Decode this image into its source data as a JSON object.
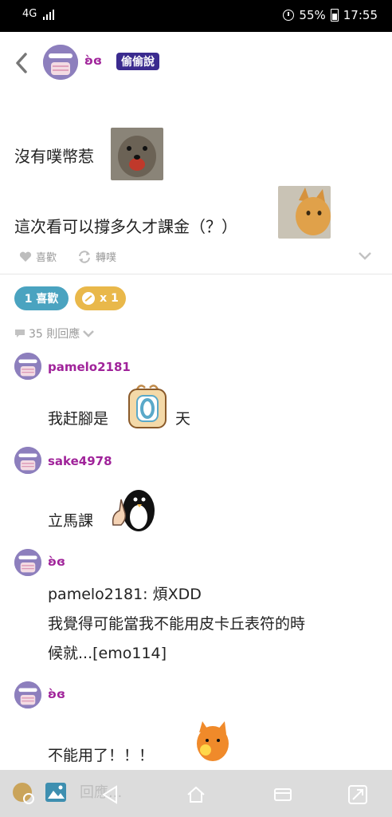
{
  "status_bar": {
    "network": "4G",
    "battery": "55%",
    "time": "17:55"
  },
  "header": {
    "author": "ʚ̀ɞ",
    "badge": "偷偷說"
  },
  "post": {
    "line1": "沒有噗幣惹",
    "line2": "這次看可以撐多久才課金（？）",
    "like_label": "喜歡",
    "replurk_label": "轉噗"
  },
  "stats": {
    "likes_pill": "1 喜歡",
    "coins_pill": "x 1"
  },
  "replies": {
    "count_label": "35 則回應"
  },
  "comments": [
    {
      "user": "pamelo2181",
      "text_before": "我赶腳是",
      "text_after": "天"
    },
    {
      "user": "sake4978",
      "text": "立馬課"
    },
    {
      "user": "ʚ̀ɞ",
      "lines": [
        "pamelo2181: 煩XDD",
        "我覺得可能當我不能用皮卡丘表符的時",
        "候就...[emo114]"
      ]
    },
    {
      "user": "ʚ̀ɞ",
      "text": "不能用了！！！"
    }
  ],
  "composer": {
    "placeholder": "回應..."
  },
  "colors": {
    "username": "#a0239a",
    "badge": "#3b2b8f",
    "likes_pill": "#4aa3c0",
    "coins_pill": "#e9b84a"
  }
}
